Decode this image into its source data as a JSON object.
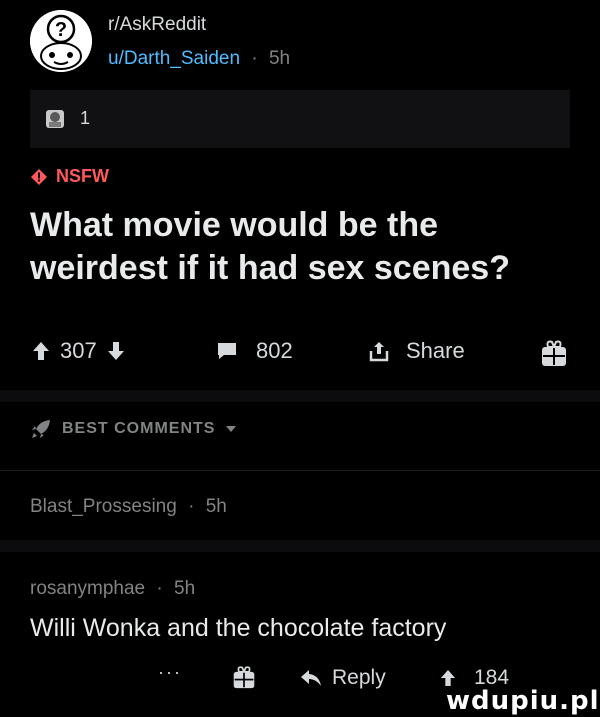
{
  "post": {
    "subreddit": "r/AskReddit",
    "author": "u/Darth_Saiden",
    "separator": "·",
    "age": "5h",
    "award_count": "1",
    "nsfw_label": "NSFW",
    "title": "What movie would be the weirdest if it had sex scenes?",
    "score": "307",
    "comments": "802",
    "share_label": "Share"
  },
  "sort": {
    "label": "BEST COMMENTS"
  },
  "comments": [
    {
      "author": "Blast_Prossesing",
      "age": "5h"
    },
    {
      "author": "rosanymphae",
      "age": "5h",
      "body": "Willi Wonka and the chocolate factory",
      "reply_label": "Reply",
      "score": "184"
    }
  ],
  "more_label": "···",
  "watermark": "wdupiu.pl",
  "colors": {
    "nsfw": "#ff585b",
    "username": "#4fbcff",
    "background": "#000000"
  }
}
